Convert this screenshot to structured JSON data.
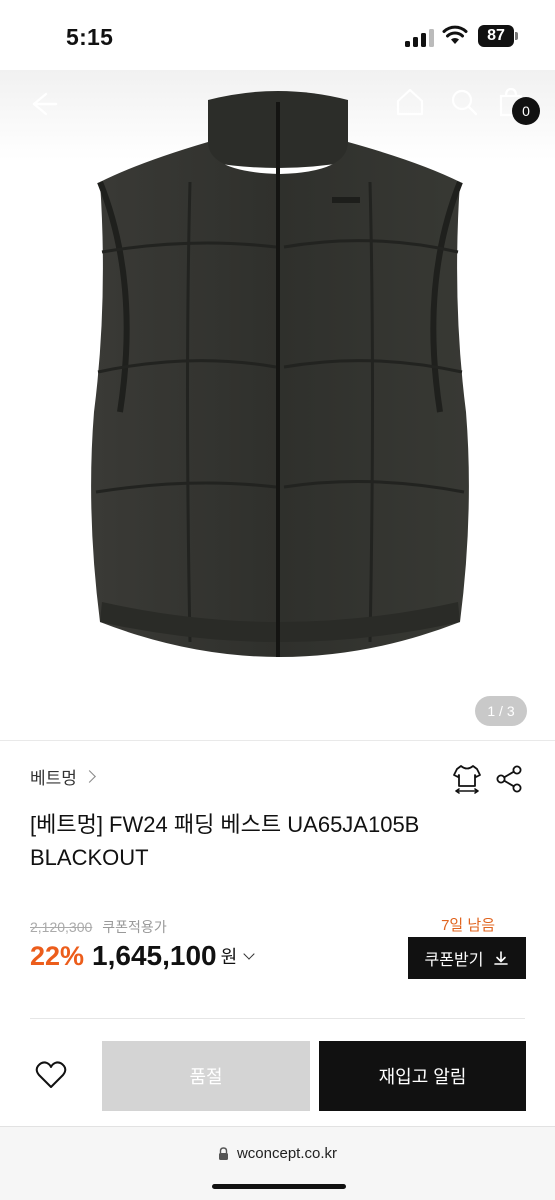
{
  "status_bar": {
    "time": "5:15",
    "battery": "87"
  },
  "nav": {
    "cart_count": "0"
  },
  "gallery": {
    "counter": "1 / 3"
  },
  "product": {
    "brand": "베트멍",
    "name": "[베트멍] FW24 패딩 베스트 UA65JA105B BLACKOUT",
    "original_price": "2,120,300",
    "coupon_applied_label": "쿠폰적용가",
    "days_left": "7일 남음",
    "discount": "22%",
    "price": "1,645,100",
    "currency": "원",
    "coupon_button": "쿠폰받기"
  },
  "actions": {
    "soldout_label": "품절",
    "restock_label": "재입고 알림"
  },
  "browser": {
    "url": "wconcept.co.kr"
  },
  "colors": {
    "accent": "#ec5d1b",
    "dark": "#111111",
    "disabled": "#d4d4d4"
  }
}
